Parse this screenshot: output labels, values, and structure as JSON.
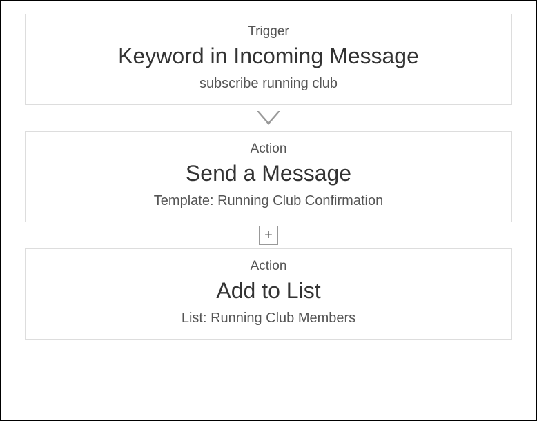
{
  "steps": [
    {
      "type": "Trigger",
      "title": "Keyword in Incoming Message",
      "detail": "subscribe running club",
      "connector": "arrow"
    },
    {
      "type": "Action",
      "title": "Send a Message",
      "detail": "Template: Running Club Confirmation",
      "connector": "plus"
    },
    {
      "type": "Action",
      "title": "Add to List",
      "detail": "List: Running Club Members",
      "connector": null
    }
  ],
  "plus_label": "+"
}
